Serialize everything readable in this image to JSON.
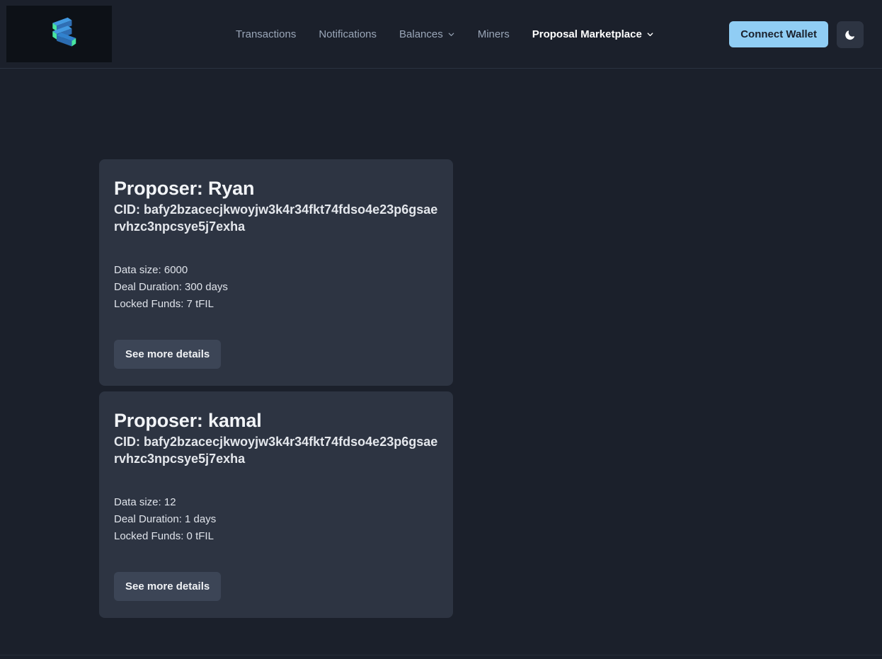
{
  "header": {
    "logo": {
      "icon": "filecoin-logo-icon",
      "alt": "Filecoin logo"
    },
    "nav": [
      {
        "label": "Transactions",
        "active": false,
        "has_chevron": false
      },
      {
        "label": "Notifications",
        "active": false,
        "has_chevron": false
      },
      {
        "label": "Balances",
        "active": false,
        "has_chevron": true
      },
      {
        "label": "Miners",
        "active": false,
        "has_chevron": false
      },
      {
        "label": "Proposal Marketplace",
        "active": true,
        "has_chevron": true
      }
    ],
    "connect_wallet_label": "Connect Wallet",
    "theme_toggle_icon": "moon-icon"
  },
  "main": {
    "proposals": [
      {
        "title": "Proposer: Ryan",
        "cid_label": "CID:",
        "cid_value": "bafy2bzacecjkwoyjw3k4r34fkt74fdso4e23p6gsaervhzc3npcsye5j7exha",
        "data_size": "Data size: 6000",
        "deal_duration": "Deal Duration: 300 days",
        "locked_funds": "Locked Funds: 7 tFIL",
        "details_label": "See more details"
      },
      {
        "title": "Proposer: kamal",
        "cid_label": "CID:",
        "cid_value": "bafy2bzacecjkwoyjw3k4r34fkt74fdso4e23p6gsaervhzc3npcsye5j7exha",
        "data_size": "Data size: 12",
        "deal_duration": "Deal Duration: 1 days",
        "locked_funds": "Locked Funds: 0 tFIL",
        "details_label": "See more details"
      }
    ]
  },
  "colors": {
    "page_background": "#1b202b",
    "card_background": "#2d3442",
    "logo_background": "#0d1117",
    "accent_button": "#90cdf4",
    "accent_button_text": "#1a202c",
    "nav_inactive_text": "#9aa6b8",
    "nav_active_text": "#ffffff",
    "details_button": "#3c4556",
    "logo_blue": "#2b6cb0",
    "logo_light_blue": "#4299e1",
    "logo_green": "#48e5a0"
  }
}
